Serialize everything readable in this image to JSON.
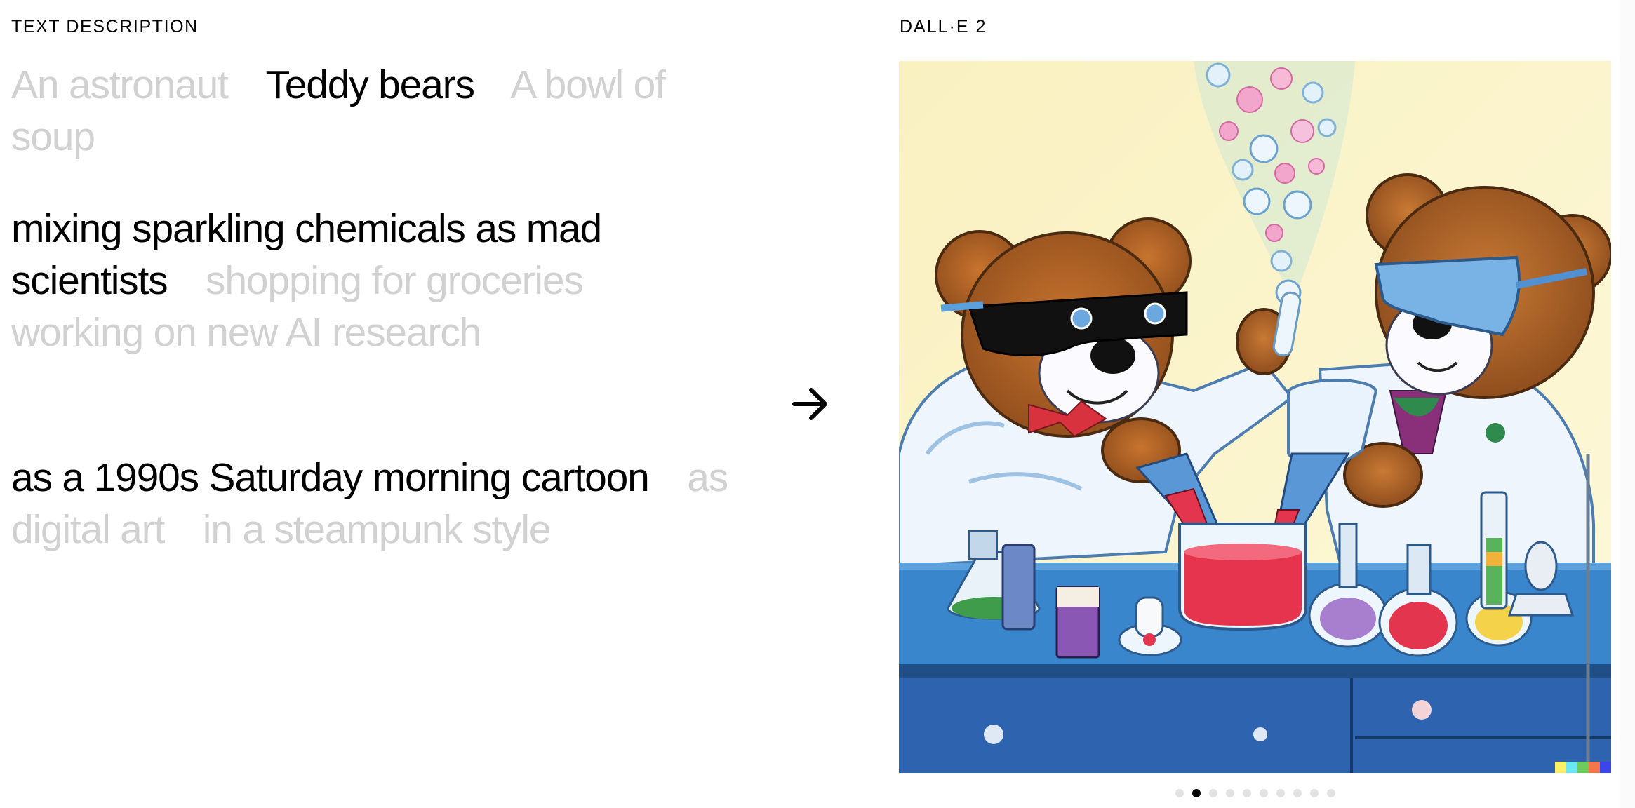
{
  "left_panel": {
    "label": "TEXT DESCRIPTION",
    "groups": [
      {
        "name": "subject",
        "options": [
          {
            "text": "An astronaut",
            "selected": false
          },
          {
            "text": "Teddy bears",
            "selected": true
          },
          {
            "text": "A bowl of soup",
            "selected": false
          }
        ]
      },
      {
        "name": "action",
        "options": [
          {
            "text": "mixing sparkling chemicals as mad scientists",
            "selected": true
          },
          {
            "text": "shopping for groceries",
            "selected": false
          },
          {
            "text": "working on new AI research",
            "selected": false
          }
        ]
      },
      {
        "name": "style",
        "options": [
          {
            "text": "as a 1990s Saturday morning cartoon",
            "selected": true
          },
          {
            "text": "as digital art",
            "selected": false
          },
          {
            "text": "in a steampunk style",
            "selected": false
          }
        ]
      }
    ]
  },
  "arrow_icon": "arrow-right-icon",
  "right_panel": {
    "label": "DALL·E 2",
    "image_alt": "Teddy bears mixing sparkling chemicals as mad scientists as a 1990s Saturday morning cartoon",
    "watermark_colors": [
      "#fef168",
      "#6ae7f5",
      "#6ecb5c",
      "#f2784b",
      "#3c45ea"
    ],
    "carousel": {
      "total": 10,
      "active_index": 1
    }
  },
  "colors": {
    "selected_text": "#000000",
    "unselected_text": "#d1d1d1",
    "dot_inactive": "#e2e2e2",
    "dot_active": "#000000"
  }
}
